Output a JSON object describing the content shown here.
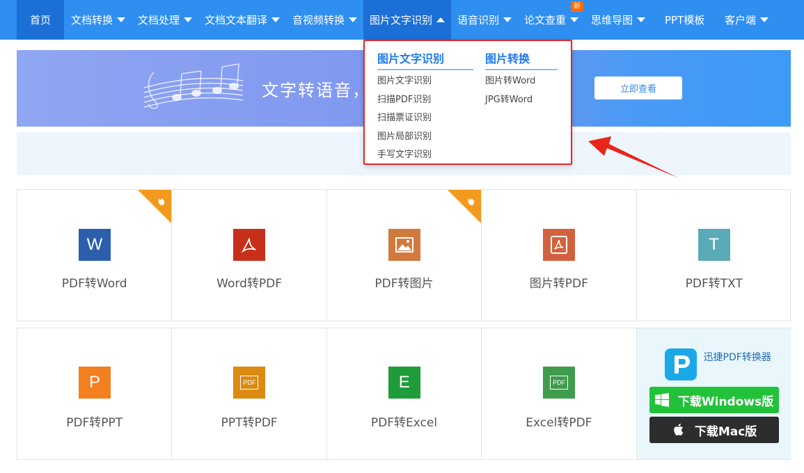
{
  "nav": {
    "items": [
      {
        "label": "首页"
      },
      {
        "label": "文档转换"
      },
      {
        "label": "文档处理"
      },
      {
        "label": "文档文本翻译"
      },
      {
        "label": "音视频转换"
      },
      {
        "label": "图片文字识别"
      },
      {
        "label": "语音识别"
      },
      {
        "label": "论文查重"
      },
      {
        "label": "思维导图"
      },
      {
        "label": "PPT模板"
      },
      {
        "label": "客户端"
      }
    ],
    "new_badge": "新",
    "accent": "#2f8ff0",
    "active_bg": "#1b6fd6"
  },
  "banner": {
    "title": "文字转语音，",
    "button": "立即查看"
  },
  "dropdown": {
    "col1": {
      "heading": "图片文字识别",
      "items": [
        "图片文字识别",
        "扫描PDF识别",
        "扫描票证识别",
        "图片局部识别",
        "手写文字识别"
      ]
    },
    "col2": {
      "heading": "图片转换",
      "items": [
        "图片转Word",
        "JPG转Word"
      ]
    },
    "highlight_color": "#e02727"
  },
  "tools_row1": [
    {
      "label": "PDF转Word",
      "icon": "word-icon",
      "glyph": "W",
      "color": "#2b5fad",
      "hot": true
    },
    {
      "label": "Word转PDF",
      "icon": "pdf-acrobat-icon",
      "glyph": "",
      "color": "#c7311c",
      "hot": false
    },
    {
      "label": "PDF转图片",
      "icon": "image-icon",
      "glyph": "",
      "color": "#d27a3d",
      "hot": true
    },
    {
      "label": "图片转PDF",
      "icon": "pdf-doc-icon",
      "glyph": "",
      "color": "#d2623e",
      "hot": false
    },
    {
      "label": "PDF转TXT",
      "icon": "txt-icon",
      "glyph": "T",
      "color": "#5aaab8",
      "hot": false
    }
  ],
  "tools_row2": [
    {
      "label": "PDF转PPT",
      "icon": "ppt-icon",
      "glyph": "P",
      "color": "#f47f1f"
    },
    {
      "label": "PPT转PDF",
      "icon": "ppt-pdf-icon",
      "glyph": "PDF",
      "color": "#dc8a12"
    },
    {
      "label": "PDF转Excel",
      "icon": "excel-icon",
      "glyph": "E",
      "color": "#1e9c3a"
    },
    {
      "label": "Excel转PDF",
      "icon": "excel-pdf-icon",
      "glyph": "PDF",
      "color": "#3f9c4c"
    }
  ],
  "download": {
    "app_name": "迅捷PDF转换器",
    "windows_label": "下载Windows版",
    "mac_label": "下载Mac版"
  }
}
